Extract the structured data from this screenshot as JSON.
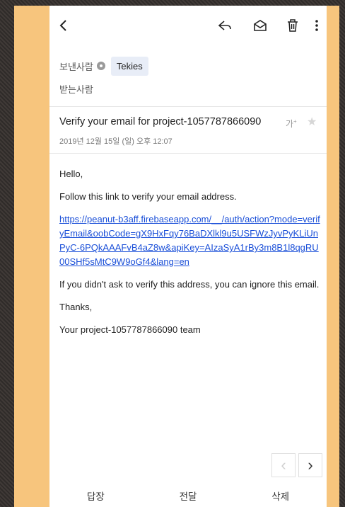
{
  "colors": {
    "background": "#3a3532",
    "accent_panel": "#f7c57d",
    "link": "#1a4fd8"
  },
  "topbar": {
    "icons": [
      "back-chevron-icon",
      "reply-icon",
      "mark-unread-icon",
      "trash-icon",
      "more-vertical-icon"
    ]
  },
  "header": {
    "sender_label": "보낸사람",
    "sender_name": "Tekies",
    "recipient_label": "받는사람"
  },
  "message": {
    "subject": "Verify your email for project-1057787866090",
    "font_size_label": "가",
    "font_size_plus": "+",
    "date": "2019년 12월 15일 (일) 오후 12:07",
    "greeting": "Hello,",
    "intro": "Follow this link to verify your email address.",
    "link": "https://peanut-b3aff.firebaseapp.com/__/auth/action?mode=verifyEmail&oobCode=gX9HxFqy76BaDXlkl9u5USFWzJyvPyKLiUnPyC-6PQkAAAFvB4aZ8w&apiKey=AIzaSyA1rBy3m8B1l8qgRU00SHf5sMtC9W9oGf4&lang=en",
    "ignore_note": "If you didn't ask to verify this address, you can ignore this email.",
    "thanks": "Thanks,",
    "signature": "Your project-1057787866090 team"
  },
  "pager": {
    "prev": "‹",
    "next": "›"
  },
  "bottom_nav": {
    "reply": "답장",
    "forward": "전달",
    "delete": "삭제"
  }
}
